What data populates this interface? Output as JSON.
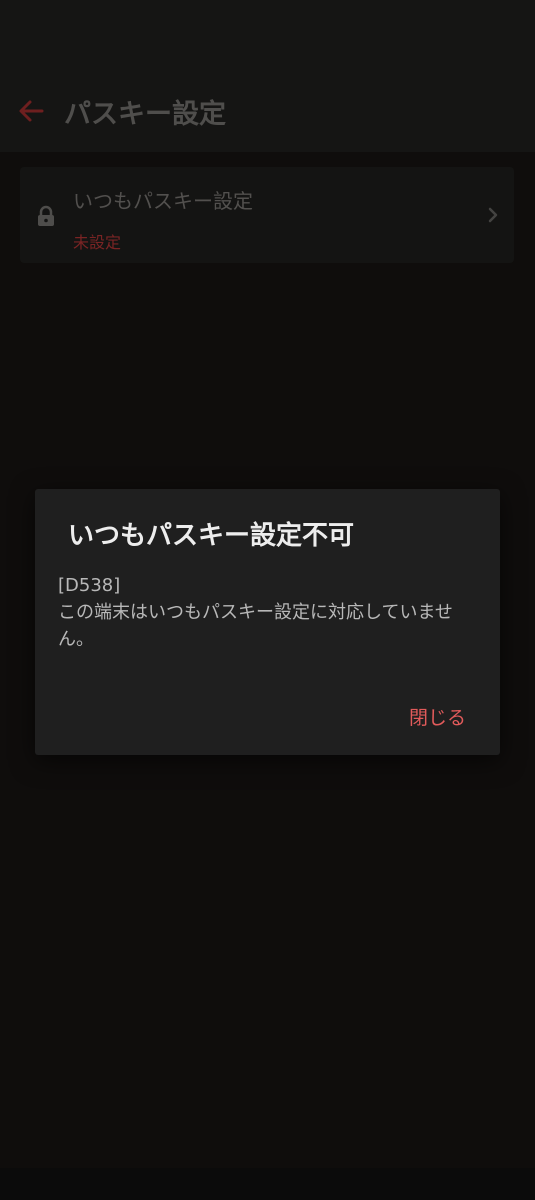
{
  "app_bar": {
    "title": "パスキー設定",
    "back_icon": "arrow-left-icon"
  },
  "setting_item": {
    "icon": "lock-icon",
    "title": "いつもパスキー設定",
    "status": "未設定",
    "chevron_icon": "chevron-right-icon"
  },
  "dialog": {
    "title": "いつもパスキー設定不可",
    "code": "[D538]",
    "message": "この端末はいつもパスキー設定に対応していません。",
    "close_label": "閉じる"
  },
  "colors": {
    "accent": "#e25b5b",
    "background": "#0f0d0c",
    "dialog_background": "#1f1f1f"
  }
}
